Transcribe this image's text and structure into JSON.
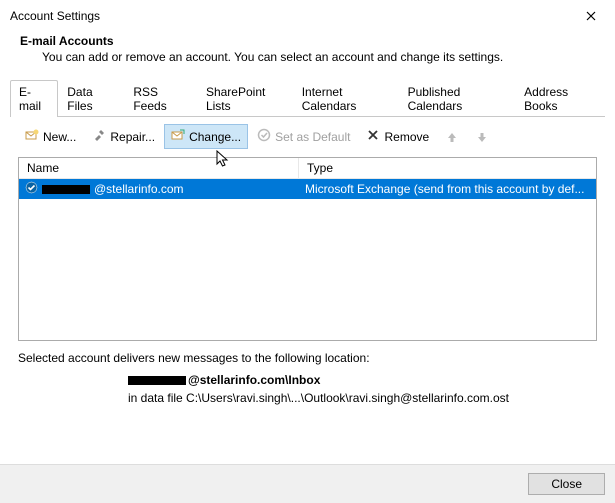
{
  "titlebar": {
    "title": "Account Settings"
  },
  "header": {
    "title": "E-mail Accounts",
    "desc": "You can add or remove an account. You can select an account and change its settings."
  },
  "tabs": [
    "E-mail",
    "Data Files",
    "RSS Feeds",
    "SharePoint Lists",
    "Internet Calendars",
    "Published Calendars",
    "Address Books"
  ],
  "toolbar": {
    "new": "New...",
    "repair": "Repair...",
    "change": "Change...",
    "setdefault": "Set as Default",
    "remove": "Remove"
  },
  "columns": {
    "name": "Name",
    "type": "Type"
  },
  "row": {
    "email_domain": "@stellarinfo.com",
    "type": "Microsoft Exchange (send from this account by def..."
  },
  "footer": {
    "label": "Selected account delivers new messages to the following location:",
    "loc_suffix": "@stellarinfo.com\\Inbox",
    "path": "in data file C:\\Users\\ravi.singh\\...\\Outlook\\ravi.singh@stellarinfo.com.ost"
  },
  "buttons": {
    "close": "Close"
  }
}
